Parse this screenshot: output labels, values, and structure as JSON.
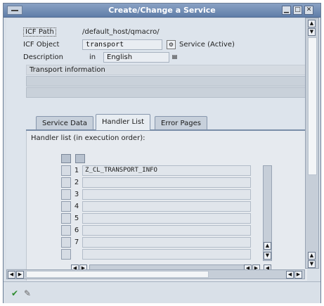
{
  "window": {
    "title": "Create/Change a Service"
  },
  "form": {
    "icf_path_label": "ICF Path",
    "icf_path_value": "/default_host/qmacro/",
    "icf_object_label": "ICF Object",
    "icf_object_value": "transport",
    "service_status": "Service (Active)",
    "description_label": "Description",
    "in_label": "in",
    "language": "English",
    "description_text": "Transport information"
  },
  "tabs": [
    {
      "label": "Service Data"
    },
    {
      "label": "Handler List"
    },
    {
      "label": "Error Pages"
    }
  ],
  "handler_list": {
    "heading": "Handler list (in execution order):",
    "rows": [
      {
        "num": "1",
        "value": "Z_CL_TRANSPORT_INFO"
      },
      {
        "num": "2",
        "value": ""
      },
      {
        "num": "3",
        "value": ""
      },
      {
        "num": "4",
        "value": ""
      },
      {
        "num": "5",
        "value": ""
      },
      {
        "num": "6",
        "value": ""
      },
      {
        "num": "7",
        "value": ""
      },
      {
        "num": "",
        "value": ""
      }
    ]
  }
}
